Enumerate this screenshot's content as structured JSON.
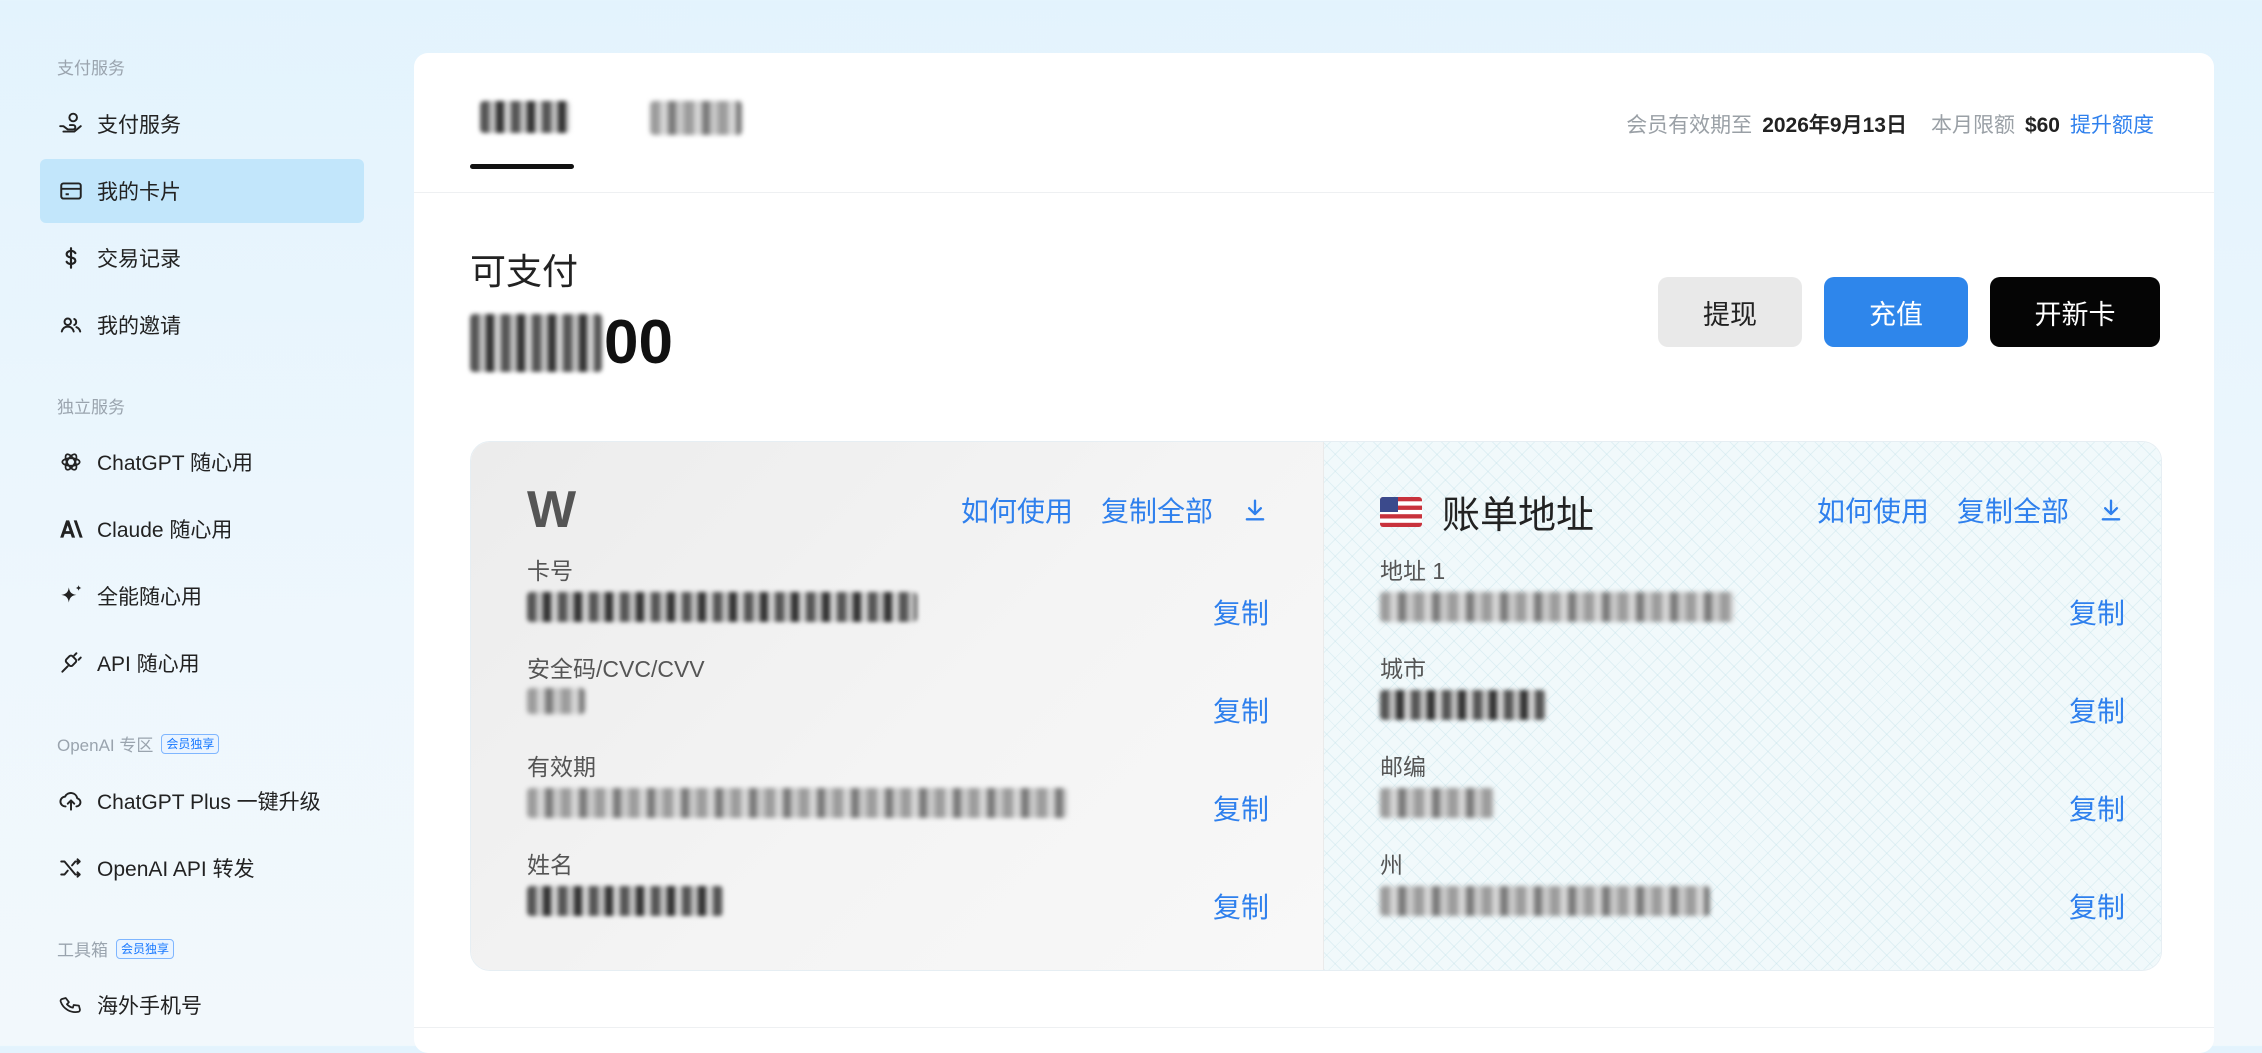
{
  "sidebar": {
    "sections": [
      {
        "label": "支付服务",
        "badge": ""
      },
      {
        "label": "独立服务",
        "badge": ""
      },
      {
        "label": "OpenAI 专区",
        "badge": "会员独享"
      },
      {
        "label": "工具箱",
        "badge": "会员独享"
      }
    ],
    "items": [
      {
        "label": "支付服务",
        "icon": "hand-coin-icon"
      },
      {
        "label": "我的卡片",
        "icon": "card-icon",
        "active": true
      },
      {
        "label": "交易记录",
        "icon": "dollar-icon"
      },
      {
        "label": "我的邀请",
        "icon": "users-icon"
      },
      {
        "label": "ChatGPT 随心用",
        "icon": "openai-icon"
      },
      {
        "label": "Claude 随心用",
        "icon": "anthropic-icon"
      },
      {
        "label": "全能随心用",
        "icon": "sparkle-icon"
      },
      {
        "label": "API 随心用",
        "icon": "plug-icon"
      },
      {
        "label": "ChatGPT Plus 一键升级",
        "icon": "upload-cloud-icon"
      },
      {
        "label": "OpenAI API 转发",
        "icon": "shuffle-icon"
      },
      {
        "label": "海外手机号",
        "icon": "phone-icon"
      }
    ]
  },
  "header": {
    "member_label": "会员有效期至",
    "member_date": "2026年9月13日",
    "limit_label": "本月限额",
    "limit_value": "$60",
    "upgrade_link": "提升额度"
  },
  "balance": {
    "label": "可支付",
    "value_visible": "00"
  },
  "buttons": {
    "withdraw": "提现",
    "topup": "充值",
    "new_card": "开新卡"
  },
  "card": {
    "logo": "W",
    "how_to_use": "如何使用",
    "copy_all": "复制全部",
    "fields": [
      {
        "label": "卡号"
      },
      {
        "label": "安全码/CVC/CVV"
      },
      {
        "label": "有效期"
      },
      {
        "label": "姓名"
      }
    ]
  },
  "billing": {
    "title": "账单地址",
    "how_to_use": "如何使用",
    "copy_all": "复制全部",
    "fields": [
      {
        "label": "地址 1"
      },
      {
        "label": "城市"
      },
      {
        "label": "邮编"
      },
      {
        "label": "州"
      }
    ]
  },
  "copy_label": "复制",
  "colors": {
    "accent": "#2e86eb",
    "link": "#2f80ed",
    "active_nav": "#c2e6fb"
  }
}
